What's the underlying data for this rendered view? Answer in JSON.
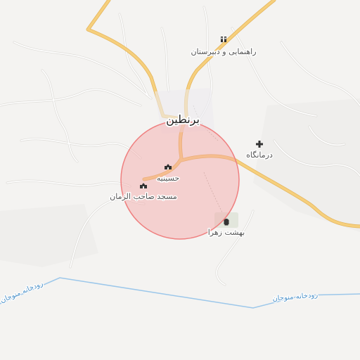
{
  "map": {
    "town_label": "برنطین",
    "circle_color": "#f08080",
    "road_color": "#f6cf7c",
    "river_color": "#9cc7ea"
  },
  "places": [
    {
      "id": "school",
      "label": "راهنمایی و دبیرستان",
      "icon": "school-icon"
    },
    {
      "id": "clinic",
      "label": "درمانگاه",
      "icon": "medical-cross-icon"
    },
    {
      "id": "hosseinieh",
      "label": "حسینیه",
      "icon": "mosque-icon"
    },
    {
      "id": "mosque",
      "label": "مسجد صاحب الزمان",
      "icon": "mosque-icon"
    },
    {
      "id": "cemetery",
      "label": "بهشت زهرا",
      "icon": "cemetery-icon"
    }
  ],
  "rivers": [
    {
      "label": "رودخانه منوجان"
    }
  ]
}
